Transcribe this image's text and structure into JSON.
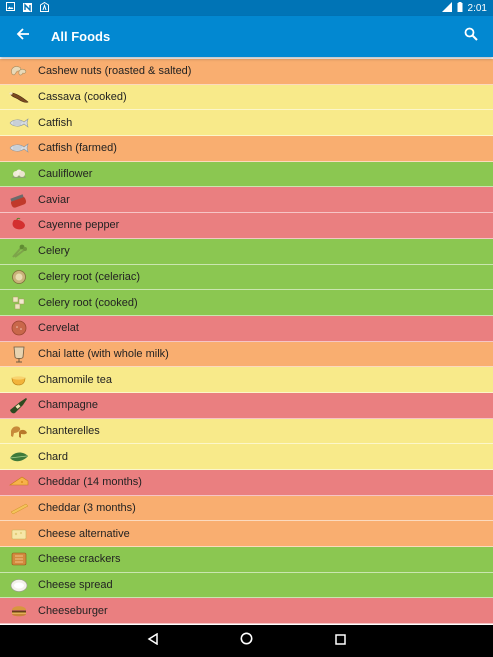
{
  "status_bar": {
    "time": "2:01",
    "left_icons": [
      "image-notification-icon",
      "n-notification-icon",
      "a-notification-icon"
    ],
    "right_icons": [
      "signal-lte-icon",
      "battery-icon"
    ]
  },
  "app_bar": {
    "title": "All Foods",
    "back_icon": "arrow-back-icon",
    "search_icon": "search-icon",
    "color": "#0288d1"
  },
  "colors": {
    "green": "#8bc751",
    "yellow": "#f8ea8a",
    "orange": "#f9ae70",
    "red": "#ea7f80"
  },
  "foods": [
    {
      "name": "Cashew nuts (roasted & salted)",
      "color": "orange",
      "icon": "cashew-icon"
    },
    {
      "name": "Cassava (cooked)",
      "color": "yellow",
      "icon": "cassava-icon"
    },
    {
      "name": "Catfish",
      "color": "yellow",
      "icon": "fish-icon"
    },
    {
      "name": "Catfish (farmed)",
      "color": "orange",
      "icon": "fish-icon"
    },
    {
      "name": "Cauliflower",
      "color": "green",
      "icon": "cauliflower-icon"
    },
    {
      "name": "Caviar",
      "color": "red",
      "icon": "caviar-icon"
    },
    {
      "name": "Cayenne pepper",
      "color": "red",
      "icon": "pepper-icon"
    },
    {
      "name": "Celery",
      "color": "green",
      "icon": "celery-icon"
    },
    {
      "name": "Celery root (celeriac)",
      "color": "green",
      "icon": "celery-root-icon"
    },
    {
      "name": "Celery root (cooked)",
      "color": "green",
      "icon": "celery-root-cooked-icon"
    },
    {
      "name": "Cervelat",
      "color": "red",
      "icon": "sausage-icon"
    },
    {
      "name": "Chai latte (with whole milk)",
      "color": "orange",
      "icon": "latte-glass-icon"
    },
    {
      "name": "Chamomile tea",
      "color": "yellow",
      "icon": "tea-cup-icon"
    },
    {
      "name": "Champagne",
      "color": "red",
      "icon": "bottle-icon"
    },
    {
      "name": "Chanterelles",
      "color": "yellow",
      "icon": "mushroom-icon"
    },
    {
      "name": "Chard",
      "color": "yellow",
      "icon": "leaf-icon"
    },
    {
      "name": "Cheddar (14 months)",
      "color": "red",
      "icon": "cheese-wedge-icon"
    },
    {
      "name": "Cheddar (3 months)",
      "color": "orange",
      "icon": "cheese-slice-icon"
    },
    {
      "name": "Cheese alternative",
      "color": "orange",
      "icon": "cheese-alt-icon"
    },
    {
      "name": "Cheese crackers",
      "color": "green",
      "icon": "cracker-icon"
    },
    {
      "name": "Cheese spread",
      "color": "green",
      "icon": "spread-icon"
    },
    {
      "name": "Cheeseburger",
      "color": "red",
      "icon": "burger-icon"
    }
  ],
  "nav_bar": {
    "buttons": [
      "back-triangle-icon",
      "home-circle-icon",
      "recents-square-icon"
    ]
  }
}
